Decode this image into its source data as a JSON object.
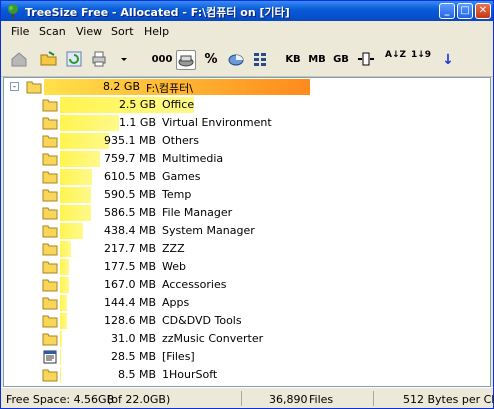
{
  "window": {
    "title": "TreeSize Free - Allocated - F:\\컴퓨터 on [기타]",
    "minimize_glyph": "_",
    "maximize_glyph": "□",
    "close_glyph": "✕"
  },
  "menu": [
    "File",
    "Scan",
    "View",
    "Sort",
    "Help"
  ],
  "toolbar": {
    "kb_label": "KB",
    "mb_label": "MB",
    "gb_label": "GB",
    "count_label": "000",
    "percent_label": "%",
    "sort_alpha_label": "A↓Z",
    "sort_num_label": "1↓9",
    "down_arrow": "↓"
  },
  "tree": {
    "root": {
      "size": "8.2 GB",
      "name": "F:\\컴퓨터\\",
      "fraction": 1.0
    },
    "rows": [
      {
        "size": "2.5 GB",
        "name": "Office",
        "fraction": 0.305,
        "kind": "folder"
      },
      {
        "size": "1.1 GB",
        "name": "Virtual Environment",
        "fraction": 0.134,
        "kind": "folder"
      },
      {
        "size": "935.1 MB",
        "name": "Others",
        "fraction": 0.111,
        "kind": "folder"
      },
      {
        "size": "759.7 MB",
        "name": "Multimedia",
        "fraction": 0.09,
        "kind": "folder"
      },
      {
        "size": "610.5 MB",
        "name": "Games",
        "fraction": 0.073,
        "kind": "folder"
      },
      {
        "size": "590.5 MB",
        "name": "Temp",
        "fraction": 0.07,
        "kind": "folder"
      },
      {
        "size": "586.5 MB",
        "name": "File Manager",
        "fraction": 0.07,
        "kind": "folder"
      },
      {
        "size": "438.4 MB",
        "name": "System Manager",
        "fraction": 0.052,
        "kind": "folder"
      },
      {
        "size": "217.7 MB",
        "name": "ZZZ",
        "fraction": 0.026,
        "kind": "folder"
      },
      {
        "size": "177.5 MB",
        "name": "Web",
        "fraction": 0.021,
        "kind": "folder"
      },
      {
        "size": "167.0 MB",
        "name": "Accessories",
        "fraction": 0.02,
        "kind": "folder"
      },
      {
        "size": "144.4 MB",
        "name": "Apps",
        "fraction": 0.017,
        "kind": "folder"
      },
      {
        "size": "128.6 MB",
        "name": "CD&DVD Tools",
        "fraction": 0.015,
        "kind": "folder"
      },
      {
        "size": "31.0 MB",
        "name": "zzMusic Converter",
        "fraction": 0.004,
        "kind": "folder"
      },
      {
        "size": "28.5 MB",
        "name": "[Files]",
        "fraction": 0.003,
        "kind": "files"
      },
      {
        "size": "8.5 MB",
        "name": "1HourSoft",
        "fraction": 0.001,
        "kind": "folder"
      }
    ]
  },
  "status": {
    "free_space": "Free Space: 4.56GB",
    "of_total": "(of 22.0GB)",
    "files_count": "36,890",
    "files_label": "Files",
    "cluster": "512 Bytes per Clu"
  },
  "colors": {
    "root_bar_start": "#ffe14a",
    "root_bar_end": "#ff8a1c",
    "child_bar": "#fff44f",
    "folder": "#f7d65a",
    "titlebar": "#0a5cd8"
  }
}
